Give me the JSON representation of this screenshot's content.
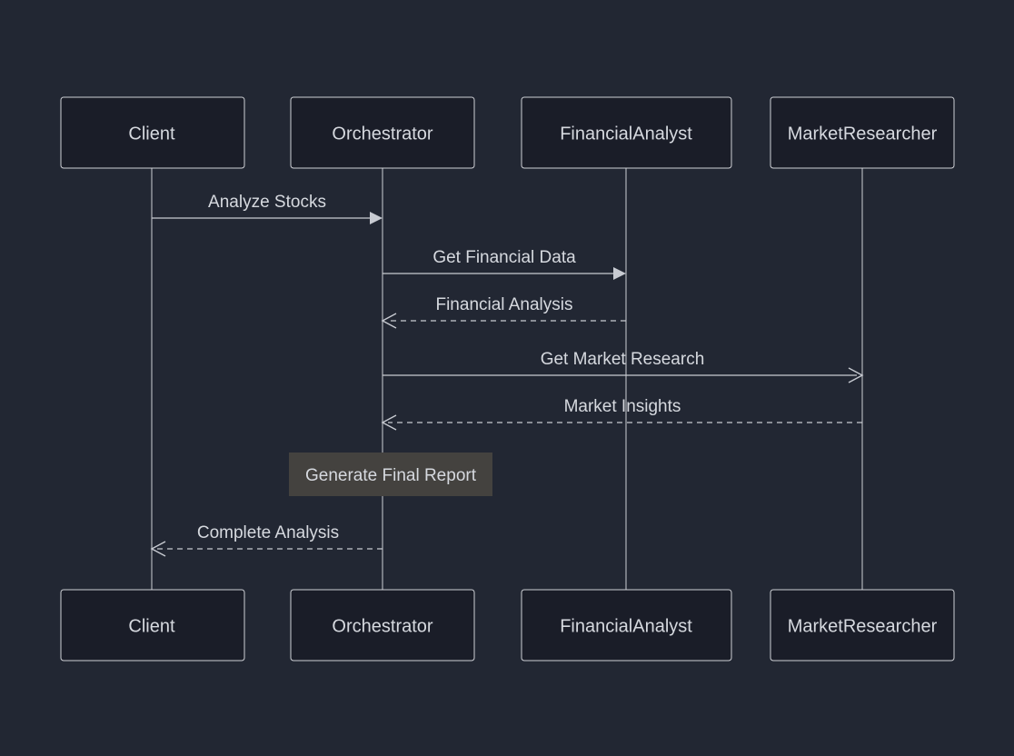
{
  "participants": {
    "p0": "Client",
    "p1": "Orchestrator",
    "p2": "FinancialAnalyst",
    "p3": "MarketResearcher"
  },
  "messages": {
    "m0": "Analyze Stocks",
    "m1": "Get Financial Data",
    "m2": "Financial Analysis",
    "m3": "Get Market Research",
    "m4": "Market Insights",
    "m5": "Complete Analysis"
  },
  "note": "Generate Final Report"
}
